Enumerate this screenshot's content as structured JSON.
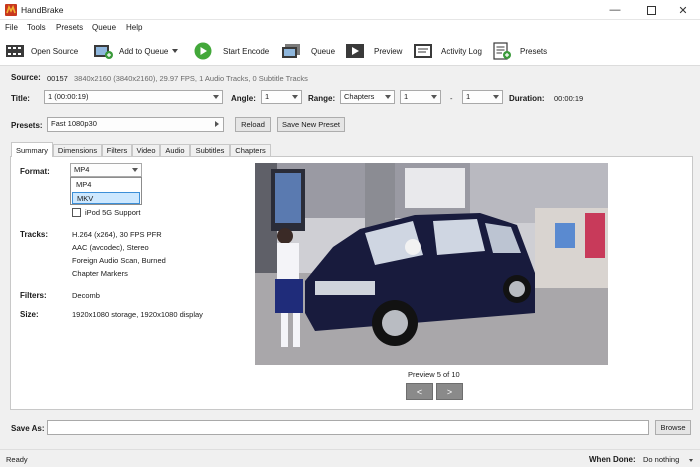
{
  "window": {
    "title": "HandBrake"
  },
  "menu": [
    "File",
    "Tools",
    "Presets",
    "Queue",
    "Help"
  ],
  "toolbar": {
    "open_source": "Open Source",
    "add_to_queue": "Add to Queue",
    "start_encode": "Start Encode",
    "queue": "Queue",
    "preview": "Preview",
    "activity_log": "Activity Log",
    "presets": "Presets"
  },
  "source": {
    "label": "Source:",
    "name": "00157",
    "info": "3840x2160 (3840x2160), 29.97 FPS, 1 Audio Tracks, 0 Subtitle Tracks"
  },
  "title_row": {
    "title_label": "Title:",
    "title_value": "1 (00:00:19)",
    "angle_label": "Angle:",
    "angle_value": "1",
    "range_label": "Range:",
    "range_mode": "Chapters",
    "range_start": "1",
    "range_dash": "-",
    "range_end": "1",
    "duration_label": "Duration:",
    "duration_value": "00:00:19"
  },
  "presets_row": {
    "label": "Presets:",
    "value": "Fast 1080p30",
    "reload": "Reload",
    "save_new": "Save New Preset"
  },
  "tabs": [
    "Summary",
    "Dimensions",
    "Filters",
    "Video",
    "Audio",
    "Subtitles",
    "Chapters"
  ],
  "summary": {
    "format_label": "Format:",
    "format_value": "MP4",
    "format_options": [
      "MP4",
      "MKV"
    ],
    "ipod_label": "iPod 5G Support",
    "tracks_label": "Tracks:",
    "tracks": [
      "H.264 (x264), 30 FPS PFR",
      "AAC (avcodec), Stereo",
      "Foreign Audio Scan, Burned",
      "Chapter Markers"
    ],
    "filters_label": "Filters:",
    "filters_value": "Decomb",
    "size_label": "Size:",
    "size_value": "1920x1080 storage, 1920x1080 display",
    "preview_caption": "Preview 5 of 10",
    "prev": "<",
    "next": ">"
  },
  "save_as": {
    "label": "Save As:",
    "value": "",
    "browse": "Browse"
  },
  "status": {
    "text": "Ready",
    "when_done_label": "When Done:",
    "when_done_value": "Do nothing"
  }
}
